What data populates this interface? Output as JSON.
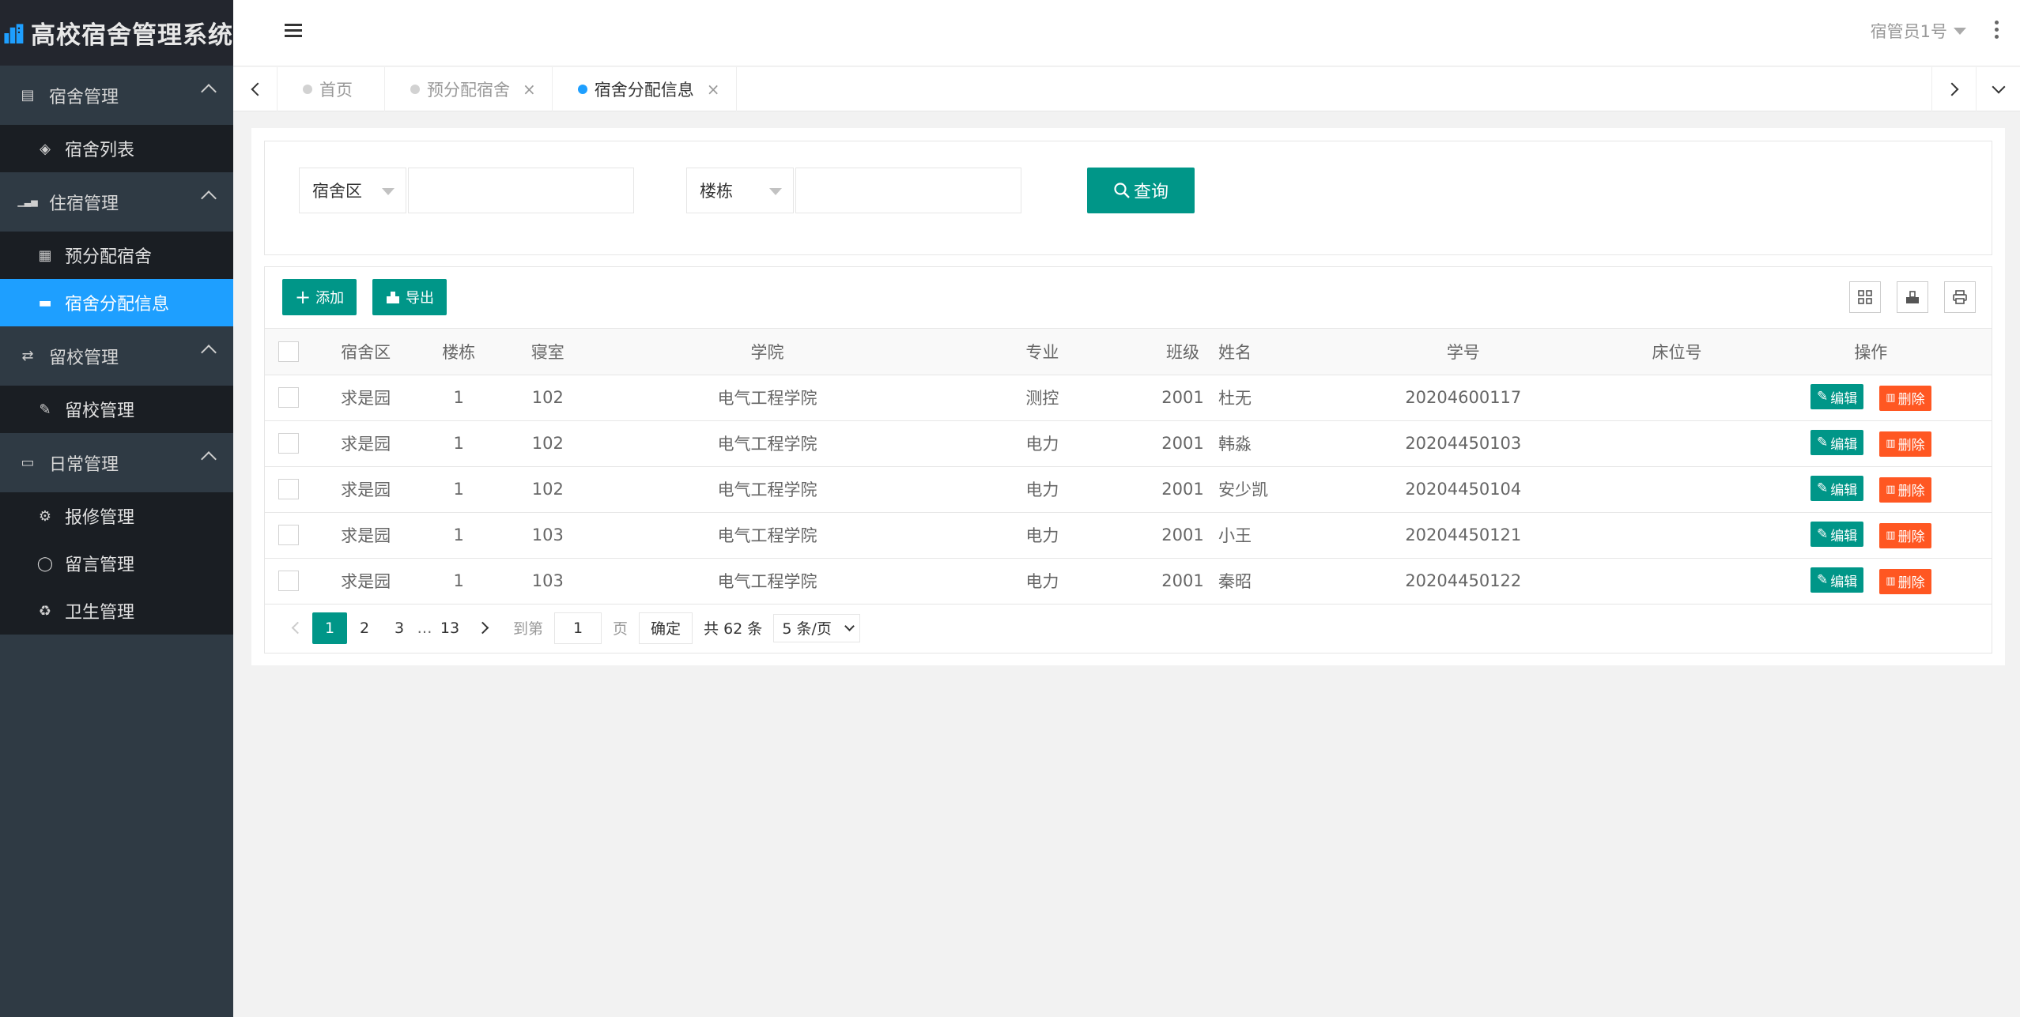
{
  "app": {
    "title": "高校宿舍管理系统",
    "user": "宿管员1号"
  },
  "sidebar": {
    "groups": [
      {
        "title": "宿舍管理",
        "icon": "building-icon",
        "items": [
          {
            "label": "宿舍列表",
            "icon": "cube-icon"
          }
        ]
      },
      {
        "title": "住宿管理",
        "icon": "signal-icon",
        "items": [
          {
            "label": "预分配宿舍",
            "icon": "id-card-icon"
          },
          {
            "label": "宿舍分配信息",
            "icon": "bed-icon",
            "active": true
          }
        ]
      },
      {
        "title": "留校管理",
        "icon": "refresh-icon",
        "items": [
          {
            "label": "留校管理",
            "icon": "edit-icon"
          }
        ]
      },
      {
        "title": "日常管理",
        "icon": "laptop-icon",
        "items": [
          {
            "label": "报修管理",
            "icon": "gear-icon"
          },
          {
            "label": "留言管理",
            "icon": "chat-icon"
          },
          {
            "label": "卫生管理",
            "icon": "recycle-icon"
          }
        ]
      }
    ]
  },
  "tabs": [
    {
      "label": "首页",
      "closable": false
    },
    {
      "label": "预分配宿舍",
      "closable": true
    },
    {
      "label": "宿舍分配信息",
      "closable": true,
      "active": true
    }
  ],
  "search": {
    "area_select": "宿舍区",
    "building_select": "楼栋",
    "button": "查询"
  },
  "toolbar": {
    "add": "添加",
    "export": "导出"
  },
  "table": {
    "columns": [
      "宿舍区",
      "楼栋",
      "寝室",
      "学院",
      "专业",
      "班级",
      "姓名",
      "学号",
      "床位号",
      "操作"
    ],
    "rows": [
      [
        "求是园",
        "1",
        "102",
        "电气工程学院",
        "测控",
        "2001",
        "杜无",
        "20204600117",
        ""
      ],
      [
        "求是园",
        "1",
        "102",
        "电气工程学院",
        "电力",
        "2001",
        "韩淼",
        "20204450103",
        ""
      ],
      [
        "求是园",
        "1",
        "102",
        "电气工程学院",
        "电力",
        "2001",
        "安少凯",
        "20204450104",
        ""
      ],
      [
        "求是园",
        "1",
        "103",
        "电气工程学院",
        "电力",
        "2001",
        "小王",
        "20204450121",
        ""
      ],
      [
        "求是园",
        "1",
        "103",
        "电气工程学院",
        "电力",
        "2001",
        "秦昭",
        "20204450122",
        ""
      ]
    ],
    "edit_label": "编辑",
    "delete_label": "删除"
  },
  "pager": {
    "pages": [
      "1",
      "2",
      "3",
      "…",
      "13"
    ],
    "current": "1",
    "goto_prefix": "到第",
    "goto_value": "1",
    "goto_suffix": "页",
    "confirm": "确定",
    "total": "共 62 条",
    "page_size": "5 条/页"
  },
  "colors": {
    "primary": "#009688",
    "danger": "#ff5722",
    "sidebar_active": "#1e9fff",
    "sidebar_bg": "#2f3a44"
  }
}
